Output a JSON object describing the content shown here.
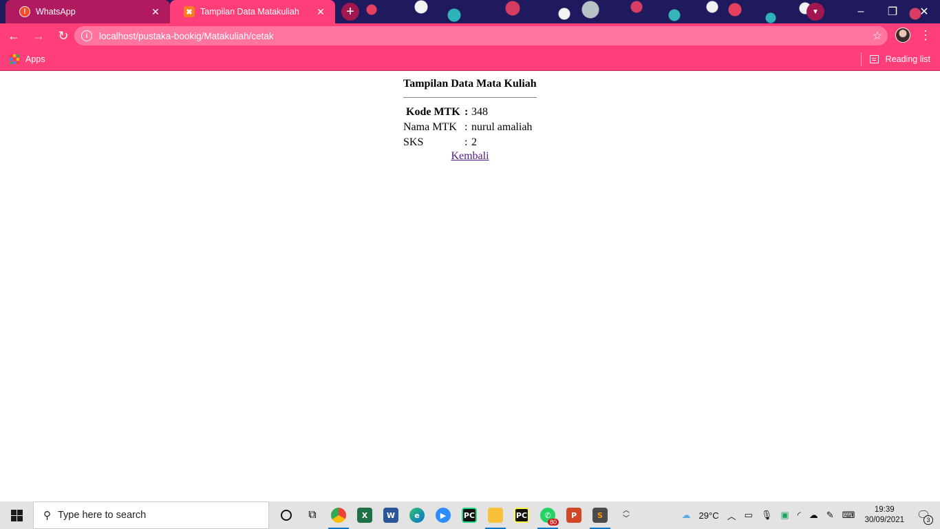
{
  "browser": {
    "tabs": [
      {
        "title": "WhatsApp",
        "icon": "whatsapp-alert-icon"
      },
      {
        "title": "Tampilan Data Matakuliah",
        "icon": "xampp-icon",
        "active": true
      }
    ],
    "url": "localhost/pustaka-bookig/Matakuliah/cetak",
    "bookmarks": {
      "apps_label": "Apps",
      "reading_list_label": "Reading list"
    },
    "theme_color": "#ff3e7a"
  },
  "page": {
    "title": "Tampilan Data Mata Kuliah",
    "rows": [
      {
        "label": "Kode MTK",
        "separator": ":",
        "value": "348"
      },
      {
        "label": "Nama MTK",
        "separator": ":",
        "value": "nurul amaliah"
      },
      {
        "label": "SKS",
        "separator": ":",
        "value": "2"
      }
    ],
    "back_link": "Kembali"
  },
  "taskbar": {
    "search_placeholder": "Type here to search",
    "apps": [
      "cortana",
      "task-view",
      "chrome",
      "excel",
      "word",
      "edge",
      "zoom",
      "pycharm",
      "file-explorer",
      "pycharm-edu",
      "whatsapp",
      "powerpoint",
      "sublime-text"
    ],
    "whatsapp_badge": "80",
    "weather": "29°C",
    "time": "19:39",
    "date": "30/09/2021",
    "notifications": "3"
  }
}
